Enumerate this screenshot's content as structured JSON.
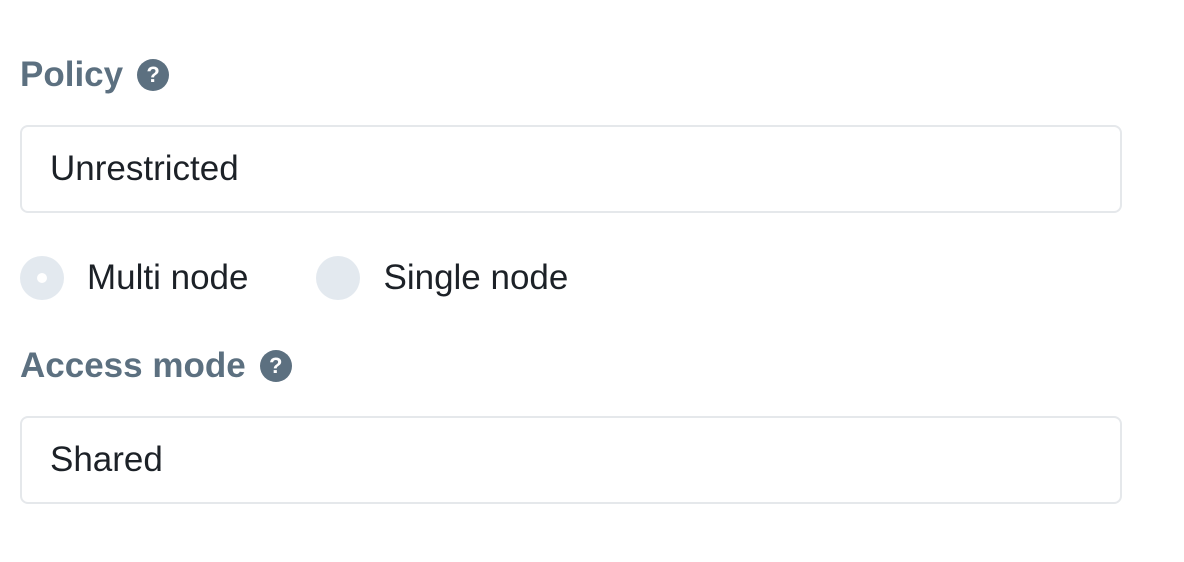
{
  "policy": {
    "label": "Policy",
    "help_icon": "question-circle-icon",
    "value": "Unrestricted"
  },
  "node_type": {
    "options": [
      {
        "label": "Multi node",
        "selected": true
      },
      {
        "label": "Single node",
        "selected": false
      }
    ]
  },
  "access_mode": {
    "label": "Access mode",
    "help_icon": "question-circle-icon",
    "value": "Shared"
  },
  "colors": {
    "label": "#5c7080",
    "text": "#1c2127",
    "border": "#e5e8eb",
    "radio_fill": "#e3e9ef"
  }
}
